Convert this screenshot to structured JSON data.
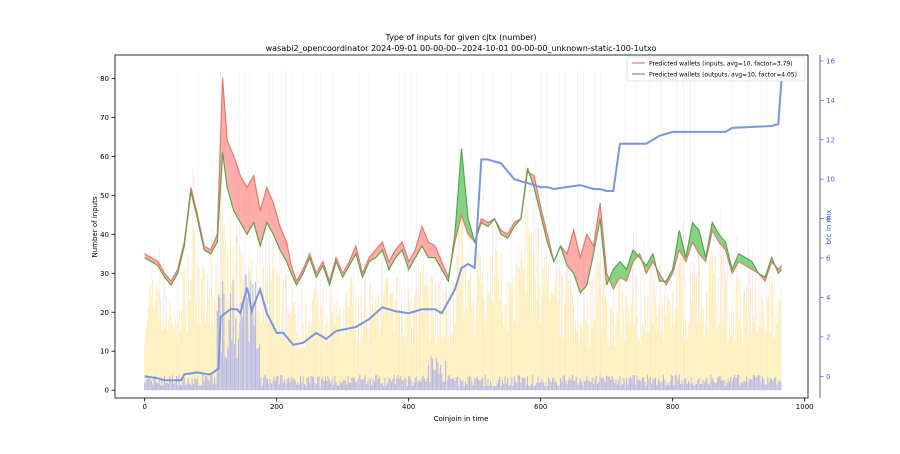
{
  "chart_data": {
    "type": "line",
    "title": "Type of inputs for given cjtx (number)",
    "subtitle": "wasabi2_opencoordinator 2024-09-01 00-00-00--2024-10-01 00-00-00_unknown-static-100-1utxo",
    "xlabel": "Coinjoin in time",
    "ylabel": "Number of inputs",
    "y2label": "btc in mix",
    "xlim": [
      -45,
      1005
    ],
    "ylim": [
      -2,
      86
    ],
    "y2lim": [
      -1.1,
      16.3
    ],
    "xticks": [
      0,
      200,
      400,
      600,
      800,
      1000
    ],
    "yticks": [
      0,
      10,
      20,
      30,
      40,
      50,
      60,
      70,
      80
    ],
    "y2ticks": [
      0,
      2,
      4,
      6,
      8,
      10,
      12,
      14,
      16
    ],
    "grid": false,
    "legend_position": "top-right",
    "colors": {
      "inputs": "#e8776d",
      "inputs_fill": "#ff8f8a",
      "outputs": "#56a848",
      "outputs_fill": "#5cc45c",
      "btc": "#7b96e0",
      "btc_axis": "#4169e1",
      "bars_yellow": "#ffe9a6",
      "bars_blue": "#9da3f5",
      "bars_pink": "#f3c4c4"
    },
    "series": [
      {
        "name": "Predicted wallets (inputs, avg=10, factor=3.79)",
        "axis": "left",
        "x": [
          0,
          10,
          20,
          30,
          40,
          50,
          60,
          70,
          80,
          90,
          100,
          110,
          118,
          125,
          135,
          145,
          155,
          165,
          175,
          185,
          195,
          205,
          215,
          222,
          230,
          240,
          250,
          260,
          270,
          280,
          290,
          300,
          310,
          320,
          330,
          340,
          350,
          360,
          370,
          380,
          390,
          400,
          410,
          420,
          430,
          440,
          450,
          460,
          470,
          480,
          490,
          500,
          510,
          520,
          530,
          540,
          550,
          560,
          570,
          580,
          590,
          600,
          610,
          620,
          630,
          640,
          650,
          660,
          670,
          680,
          690,
          700,
          710,
          720,
          730,
          740,
          750,
          760,
          770,
          780,
          790,
          800,
          810,
          820,
          830,
          840,
          850,
          860,
          870,
          880,
          890,
          900,
          910,
          920,
          930,
          940,
          950,
          960,
          965
        ],
        "values": [
          35,
          34,
          33,
          30,
          28,
          31,
          38,
          52,
          45,
          37,
          36,
          40,
          80,
          64,
          60,
          55,
          52,
          55,
          46,
          52,
          48,
          42,
          38,
          32,
          28,
          31,
          35,
          30,
          33,
          28,
          34,
          30,
          33,
          37,
          30,
          34,
          36,
          38,
          33,
          36,
          38,
          33,
          36,
          42,
          38,
          37,
          33,
          29,
          38,
          45,
          40,
          38,
          44,
          43,
          44,
          41,
          40,
          43,
          44,
          56,
          55,
          47,
          40,
          33,
          37,
          35,
          41,
          34,
          40,
          37,
          48,
          30,
          26,
          29,
          28,
          33,
          35,
          30,
          33,
          30,
          27,
          30,
          36,
          33,
          38,
          35,
          33,
          41,
          38,
          36,
          30,
          33,
          32,
          31,
          30,
          28,
          33,
          31,
          32
        ]
      },
      {
        "name": "Predicted wallets (outputs, avg=10, factor=4.05)",
        "axis": "left",
        "x": [
          0,
          10,
          20,
          30,
          40,
          50,
          60,
          70,
          80,
          90,
          100,
          110,
          118,
          125,
          135,
          145,
          155,
          165,
          175,
          185,
          195,
          205,
          215,
          222,
          230,
          240,
          250,
          260,
          270,
          280,
          290,
          300,
          310,
          320,
          330,
          340,
          350,
          360,
          370,
          380,
          390,
          400,
          410,
          420,
          430,
          440,
          450,
          460,
          470,
          480,
          490,
          500,
          510,
          520,
          530,
          540,
          550,
          560,
          570,
          580,
          590,
          600,
          610,
          620,
          630,
          640,
          650,
          660,
          670,
          680,
          690,
          700,
          710,
          720,
          730,
          740,
          750,
          760,
          770,
          780,
          790,
          800,
          810,
          820,
          830,
          840,
          850,
          860,
          870,
          880,
          890,
          900,
          910,
          920,
          930,
          940,
          950,
          960,
          965
        ],
        "values": [
          34,
          33,
          32,
          29,
          27,
          30,
          37,
          51,
          44,
          36,
          35,
          38,
          61,
          52,
          46,
          43,
          40,
          43,
          37,
          43,
          40,
          36,
          33,
          30,
          27,
          30,
          34,
          29,
          32,
          27,
          33,
          29,
          32,
          35,
          29,
          33,
          34,
          36,
          31,
          34,
          36,
          31,
          34,
          37,
          34,
          34,
          31,
          28,
          40,
          62,
          44,
          38,
          43,
          42,
          44,
          40,
          39,
          42,
          44,
          57,
          52,
          45,
          38,
          33,
          37,
          32,
          30,
          25,
          27,
          35,
          44,
          27,
          31,
          33,
          31,
          36,
          34,
          32,
          35,
          28,
          28,
          31,
          41,
          34,
          43,
          41,
          34,
          43,
          40,
          38,
          31,
          35,
          34,
          33,
          30,
          29,
          34,
          30,
          31
        ]
      },
      {
        "name": "btc in mix",
        "axis": "right",
        "x": [
          0,
          20,
          30,
          40,
          55,
          60,
          80,
          95,
          100,
          112,
          115,
          118,
          130,
          140,
          145,
          155,
          158,
          162,
          170,
          175,
          185,
          200,
          210,
          225,
          240,
          260,
          275,
          290,
          320,
          340,
          360,
          380,
          400,
          420,
          440,
          450,
          460,
          470,
          480,
          490,
          500,
          510,
          515,
          520,
          540,
          560,
          570,
          580,
          600,
          610,
          620,
          660,
          680,
          690,
          700,
          710,
          720,
          730,
          760,
          780,
          800,
          880,
          890,
          950,
          960,
          965
        ],
        "values": [
          0,
          -0.1,
          -0.2,
          -0.2,
          -0.2,
          0.1,
          0.2,
          0.1,
          0.1,
          0.4,
          3.0,
          3.1,
          3.4,
          3.4,
          3.2,
          4.5,
          4.1,
          3.3,
          4.0,
          4.4,
          3.2,
          2.2,
          2.2,
          1.6,
          1.7,
          2.2,
          1.9,
          2.3,
          2.5,
          2.9,
          3.5,
          3.3,
          3.2,
          3.4,
          3.4,
          3.2,
          3.8,
          4.4,
          5.5,
          5.7,
          5.5,
          11.0,
          11.0,
          11.0,
          10.8,
          10.0,
          9.9,
          9.8,
          9.6,
          9.6,
          9.5,
          9.7,
          9.5,
          9.5,
          9.4,
          9.4,
          11.8,
          11.8,
          11.8,
          12.2,
          12.4,
          12.4,
          12.6,
          12.7,
          12.8,
          15.1
        ]
      }
    ],
    "legend": [
      "Predicted wallets (inputs, avg=10, factor=3.79)",
      "Predicted wallets (outputs, avg=10, factor=4.05)"
    ]
  }
}
